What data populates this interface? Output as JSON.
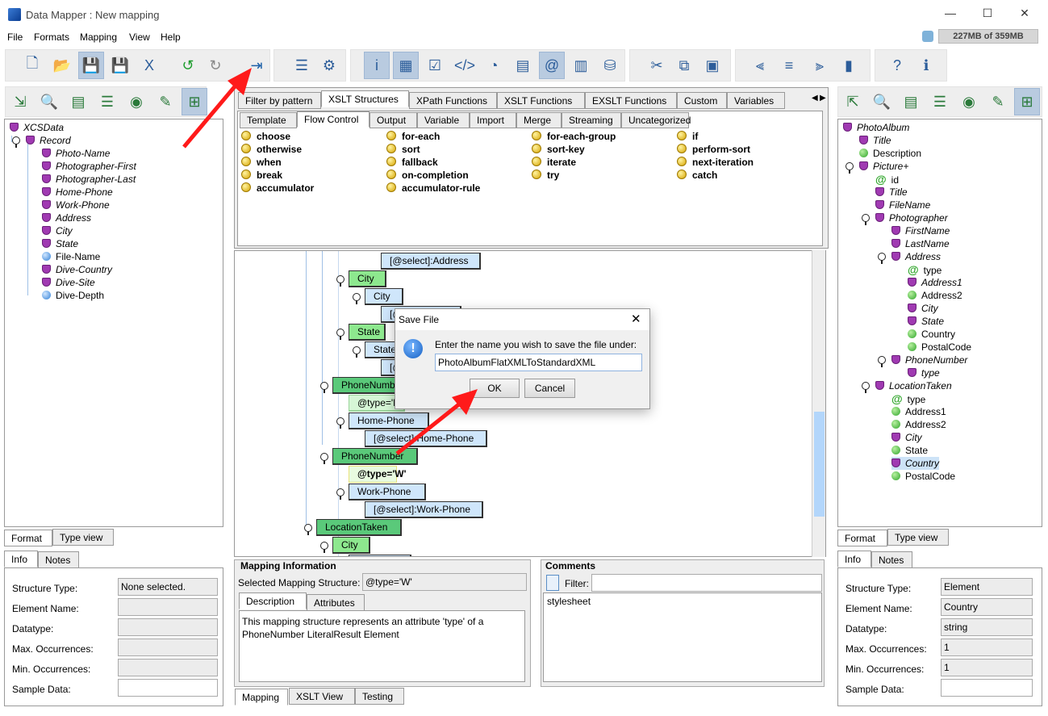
{
  "window": {
    "title": "Data Mapper : New mapping",
    "memory": "227MB of 359MB"
  },
  "menu": [
    "File",
    "Formats",
    "Mapping",
    "View",
    "Help"
  ],
  "toolbar_icons": [
    "new-file-icon",
    "open-folder-icon",
    "save-icon",
    "save-as-icon",
    "export-xls-icon",
    "undo-icon",
    "redo-icon",
    "exit-door-icon",
    "add-mapping-icon",
    "mapping-settings-icon",
    "info-view-icon",
    "color-view-icon",
    "checklist-icon",
    "xml-code-icon",
    "save-timer-icon",
    "document-icon",
    "at-symbol-icon",
    "table-view-icon",
    "database-icon",
    "cut-icon",
    "copy-icon",
    "paste-icon",
    "align-left-icon",
    "align-center-icon",
    "align-right-icon",
    "color-columns-icon",
    "help-icon",
    "about-icon"
  ],
  "left_toolbar_icons": [
    "import-icon",
    "search-replace-icon",
    "notes-icon",
    "list-icon",
    "preview-icon",
    "edit-icon",
    "tree-select-icon"
  ],
  "right_toolbar_icons": [
    "export-icon",
    "search-replace-icon",
    "notes-icon",
    "list-icon",
    "preview-icon",
    "edit-icon",
    "tree-select-icon"
  ],
  "left_tree": [
    {
      "label": "XCSData",
      "type": "el",
      "italic": true
    },
    {
      "label": "Record",
      "type": "el",
      "italic": true
    },
    {
      "label": "Photo-Name",
      "type": "el",
      "italic": true
    },
    {
      "label": "Photographer-First",
      "type": "el",
      "italic": true
    },
    {
      "label": "Photographer-Last",
      "type": "el",
      "italic": true
    },
    {
      "label": "Home-Phone",
      "type": "el",
      "italic": true
    },
    {
      "label": "Work-Phone",
      "type": "el",
      "italic": true
    },
    {
      "label": "Address",
      "type": "el",
      "italic": true
    },
    {
      "label": "City",
      "type": "el",
      "italic": true
    },
    {
      "label": "State",
      "type": "el",
      "italic": true
    },
    {
      "label": "File-Name",
      "type": "bl",
      "italic": false
    },
    {
      "label": "Dive-Country",
      "type": "el",
      "italic": true
    },
    {
      "label": "Dive-Site",
      "type": "el",
      "italic": true
    },
    {
      "label": "Dive-Depth",
      "type": "bl",
      "italic": false
    }
  ],
  "right_tree": [
    {
      "label": "PhotoAlbum",
      "type": "el",
      "italic": true
    },
    {
      "label": "Title",
      "type": "el",
      "italic": true
    },
    {
      "label": "Description",
      "type": "gr",
      "italic": false
    },
    {
      "label": "Picture+",
      "type": "el",
      "italic": true
    },
    {
      "label": "id",
      "type": "at",
      "italic": false
    },
    {
      "label": "Title",
      "type": "el",
      "italic": true
    },
    {
      "label": "FileName",
      "type": "el",
      "italic": true
    },
    {
      "label": "Photographer",
      "type": "el",
      "italic": true
    },
    {
      "label": "FirstName",
      "type": "el",
      "italic": true
    },
    {
      "label": "LastName",
      "type": "el",
      "italic": true
    },
    {
      "label": "Address",
      "type": "el",
      "italic": true
    },
    {
      "label": "type",
      "type": "at",
      "italic": false
    },
    {
      "label": "Address1",
      "type": "el",
      "italic": true
    },
    {
      "label": "Address2",
      "type": "gr",
      "italic": false
    },
    {
      "label": "City",
      "type": "el",
      "italic": true
    },
    {
      "label": "State",
      "type": "el",
      "italic": true
    },
    {
      "label": "Country",
      "type": "gr",
      "italic": false
    },
    {
      "label": "PostalCode",
      "type": "gr",
      "italic": false
    },
    {
      "label": "PhoneNumber",
      "type": "el",
      "italic": true
    },
    {
      "label": "type",
      "type": "el",
      "italic": true
    },
    {
      "label": "LocationTaken",
      "type": "el",
      "italic": true
    },
    {
      "label": "type",
      "type": "at",
      "italic": false
    },
    {
      "label": "Address1",
      "type": "gr",
      "italic": false
    },
    {
      "label": "Address2",
      "type": "gr",
      "italic": false
    },
    {
      "label": "City",
      "type": "el",
      "italic": true
    },
    {
      "label": "State",
      "type": "gr",
      "italic": false
    },
    {
      "label": "Country",
      "type": "el",
      "italic": true,
      "selected": true
    },
    {
      "label": "PostalCode",
      "type": "gr",
      "italic": false
    }
  ],
  "left_tabs": {
    "format": "Format",
    "type_view": "Type view",
    "info": "Info",
    "notes": "Notes"
  },
  "right_tabs": {
    "format": "Format",
    "type_view": "Type view",
    "info": "Info",
    "notes": "Notes"
  },
  "info_labels": [
    "Structure Type:",
    "Element Name:",
    "Datatype:",
    "Max. Occurrences:",
    "Min. Occurrences:",
    "Sample Data:"
  ],
  "left_info_values": [
    "None selected.",
    "",
    "",
    "",
    "",
    ""
  ],
  "right_info_values": [
    "Element",
    "Country",
    "string",
    "1",
    "1",
    ""
  ],
  "palette": {
    "tabs": [
      "Filter by pattern",
      "XSLT Structures",
      "XPath Functions",
      "XSLT Functions",
      "EXSLT Functions",
      "Custom",
      "Variables"
    ],
    "subtabs": [
      "Template",
      "Flow Control",
      "Output",
      "Variable",
      "Import",
      "Merge",
      "Streaming",
      "Uncategorized"
    ],
    "items": [
      [
        "choose",
        "otherwise",
        "when",
        "break",
        "accumulator"
      ],
      [
        "for-each",
        "sort",
        "fallback",
        "on-completion",
        "accumulator-rule"
      ],
      [
        "for-each-group",
        "sort-key",
        "iterate",
        "try"
      ],
      [
        "if",
        "perform-sort",
        "next-iteration",
        "catch"
      ]
    ]
  },
  "mapping_nodes": [
    "[@select]:Address",
    "City",
    "City",
    "[@select]:City",
    "State",
    "State",
    "[@select]:State",
    "PhoneNumber",
    "@type='H'",
    "Home-Phone",
    "[@select]:Home-Phone",
    "PhoneNumber",
    "@type='W'",
    "Work-Phone",
    "[@select]:Work-Phone",
    "LocationTaken",
    "City",
    ""
  ],
  "mapping_info": {
    "title": "Mapping Information",
    "selected_label": "Selected Mapping Structure:",
    "selected_value": "@type='W'",
    "tabs": [
      "Description",
      "Attributes"
    ],
    "description": "This mapping structure represents an attribute 'type' of a PhoneNumber LiteralResult Element"
  },
  "comments": {
    "title": "Comments",
    "filter_label": "Filter:",
    "filter_value": "",
    "items": [
      "stylesheet"
    ]
  },
  "bottom_tabs": [
    "Mapping",
    "XSLT View",
    "Testing"
  ],
  "dialog": {
    "title": "Save File",
    "message": "Enter the name you wish to save the file under:",
    "value": "PhotoAlbumFlatXMLToStandardXML",
    "ok": "OK",
    "cancel": "Cancel"
  },
  "colors": {
    "annotation_arrow": "#ff1a1a",
    "selection": "#cde3f7",
    "element_node": "#5ac97a",
    "literal_node": "#cfe6fb"
  }
}
